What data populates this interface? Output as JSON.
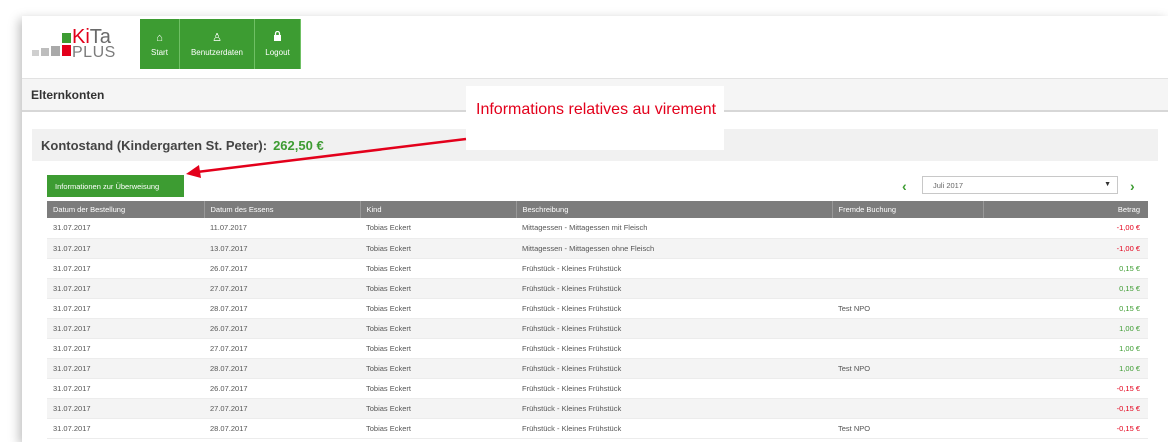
{
  "colors": {
    "accent": "#3d9c32",
    "red": "#e3001b",
    "header_grey": "#7c7c7c"
  },
  "logo": {
    "line1_a": "Ki",
    "line1_b": "Ta",
    "line2": "PLUS"
  },
  "nav": [
    {
      "label": "Start",
      "icon": "home-icon",
      "glyph": "⌂"
    },
    {
      "label": "Benutzerdaten",
      "icon": "user-icon",
      "glyph": "♙"
    },
    {
      "label": "Logout",
      "icon": "lock-icon",
      "glyph": "🔒"
    }
  ],
  "page_title": "Elternkonten",
  "kontostand": {
    "label": "Kontostand (Kindergarten St. Peter):",
    "amount": "262,50 €"
  },
  "annotation": {
    "text": "Informations relatives au virement"
  },
  "info_button": "Informationen zur Überweisung",
  "month_select": {
    "value": "Juli 2017"
  },
  "table": {
    "headers": [
      "Datum der Bestellung",
      "Datum des Essens",
      "Kind",
      "Beschreibung",
      "Fremde Buchung",
      "Betrag"
    ],
    "rows": [
      [
        "31.07.2017",
        "11.07.2017",
        "Tobias Eckert",
        "Mittagessen - Mittagessen mit Fleisch",
        "",
        "-1,00 €"
      ],
      [
        "31.07.2017",
        "13.07.2017",
        "Tobias Eckert",
        "Mittagessen - Mittagessen ohne Fleisch",
        "",
        "-1,00 €"
      ],
      [
        "31.07.2017",
        "26.07.2017",
        "Tobias Eckert",
        "Frühstück - Kleines Frühstück",
        "",
        "0,15 €"
      ],
      [
        "31.07.2017",
        "27.07.2017",
        "Tobias Eckert",
        "Frühstück - Kleines Frühstück",
        "",
        "0,15 €"
      ],
      [
        "31.07.2017",
        "28.07.2017",
        "Tobias Eckert",
        "Frühstück - Kleines Frühstück",
        "Test NPO",
        "0,15 €"
      ],
      [
        "31.07.2017",
        "26.07.2017",
        "Tobias Eckert",
        "Frühstück - Kleines Frühstück",
        "",
        "1,00 €"
      ],
      [
        "31.07.2017",
        "27.07.2017",
        "Tobias Eckert",
        "Frühstück - Kleines Frühstück",
        "",
        "1,00 €"
      ],
      [
        "31.07.2017",
        "28.07.2017",
        "Tobias Eckert",
        "Frühstück - Kleines Frühstück",
        "Test NPO",
        "1,00 €"
      ],
      [
        "31.07.2017",
        "26.07.2017",
        "Tobias Eckert",
        "Frühstück - Kleines Frühstück",
        "",
        "-0,15 €"
      ],
      [
        "31.07.2017",
        "27.07.2017",
        "Tobias Eckert",
        "Frühstück - Kleines Frühstück",
        "",
        "-0,15 €"
      ],
      [
        "31.07.2017",
        "28.07.2017",
        "Tobias Eckert",
        "Frühstück - Kleines Frühstück",
        "Test NPO",
        "-0,15 €"
      ]
    ]
  }
}
